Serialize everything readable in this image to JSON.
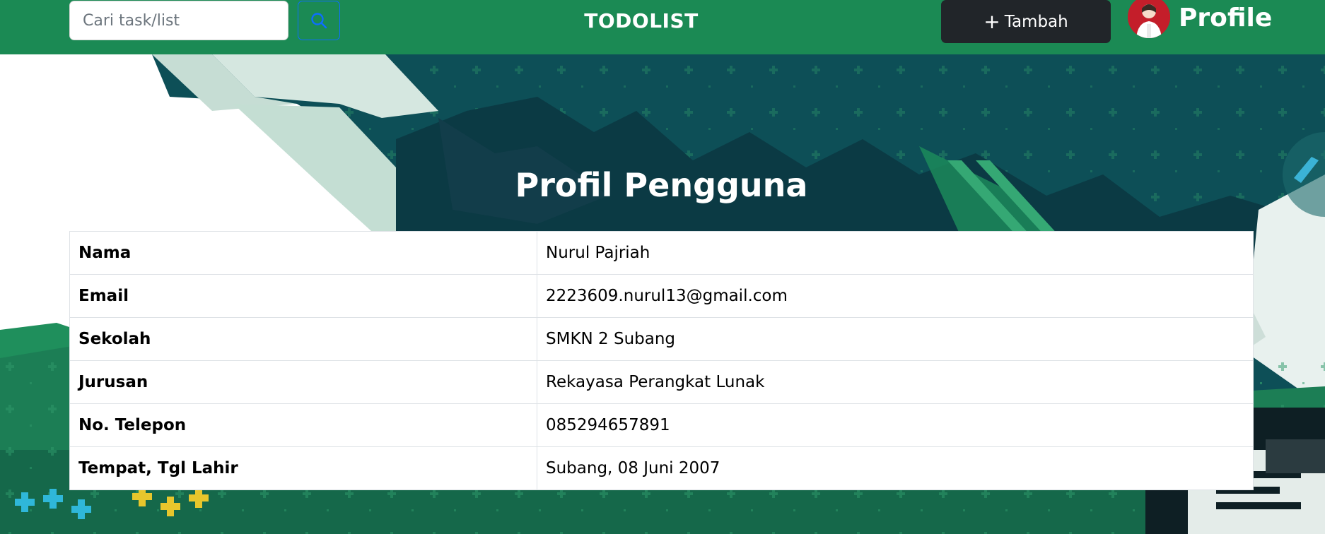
{
  "navbar": {
    "search": {
      "placeholder": "Cari task/list",
      "value": ""
    },
    "search_icon": "search-icon",
    "brand": "TODOLIST",
    "add_button": {
      "icon": "+",
      "label": "Tambah"
    },
    "profile_label": "Profile"
  },
  "main": {
    "title": "Profil Pengguna",
    "profile_rows": [
      {
        "label": "Nama",
        "value": "Nurul Pajriah"
      },
      {
        "label": "Email",
        "value": "2223609.nurul13@gmail.com"
      },
      {
        "label": "Sekolah",
        "value": "SMKN 2 Subang"
      },
      {
        "label": "Jurusan",
        "value": "Rekayasa Perangkat Lunak"
      },
      {
        "label": "No. Telepon",
        "value": "085294657891"
      },
      {
        "label": "Tempat, Tgl Lahir",
        "value": "Subang, 08 Juni 2007"
      }
    ]
  },
  "colors": {
    "navbar": "#1b8a54",
    "add_button": "#212529",
    "search_button_border": "#0d6efd",
    "background_dark": "#0b4a52",
    "background_green": "#1f8f5c"
  }
}
